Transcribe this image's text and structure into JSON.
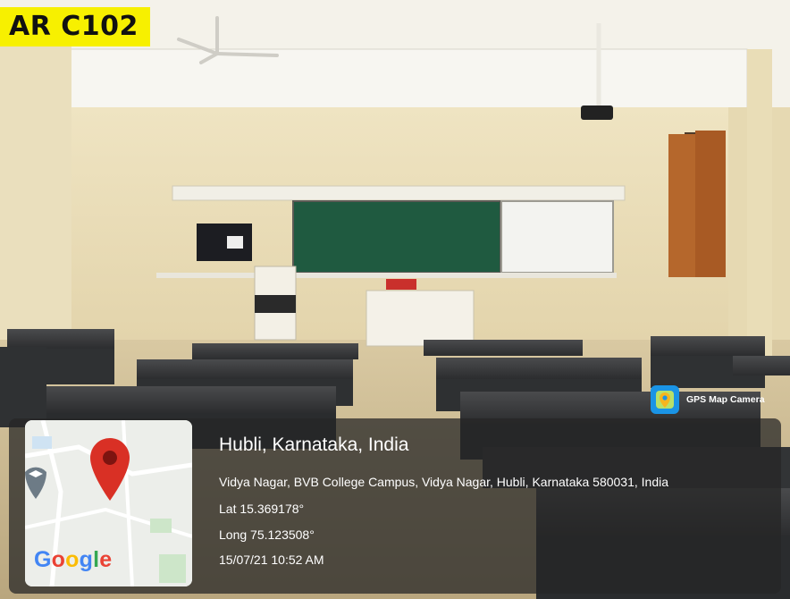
{
  "photo": {
    "room_tag": "AR C102",
    "description_colors": {
      "wall": "#e8dcb6",
      "floor": "#d4c39c",
      "board_green": "#1f5a40",
      "bench_top": "#3b3c3e"
    }
  },
  "geotag": {
    "app_badge": "GPS Map Camera",
    "app_icon": "map-pin-camera-icon",
    "place": "Hubli, Karnataka, India",
    "address": "Vidya Nagar, BVB College Campus, Vidya Nagar, Hubli, Karnataka 580031, India",
    "lat": "Lat 15.369178°",
    "long": "Long 75.123508°",
    "datetime": "15/07/21 10:52 AM",
    "map_brand": "Google",
    "map_pin_color": "#d93025"
  }
}
